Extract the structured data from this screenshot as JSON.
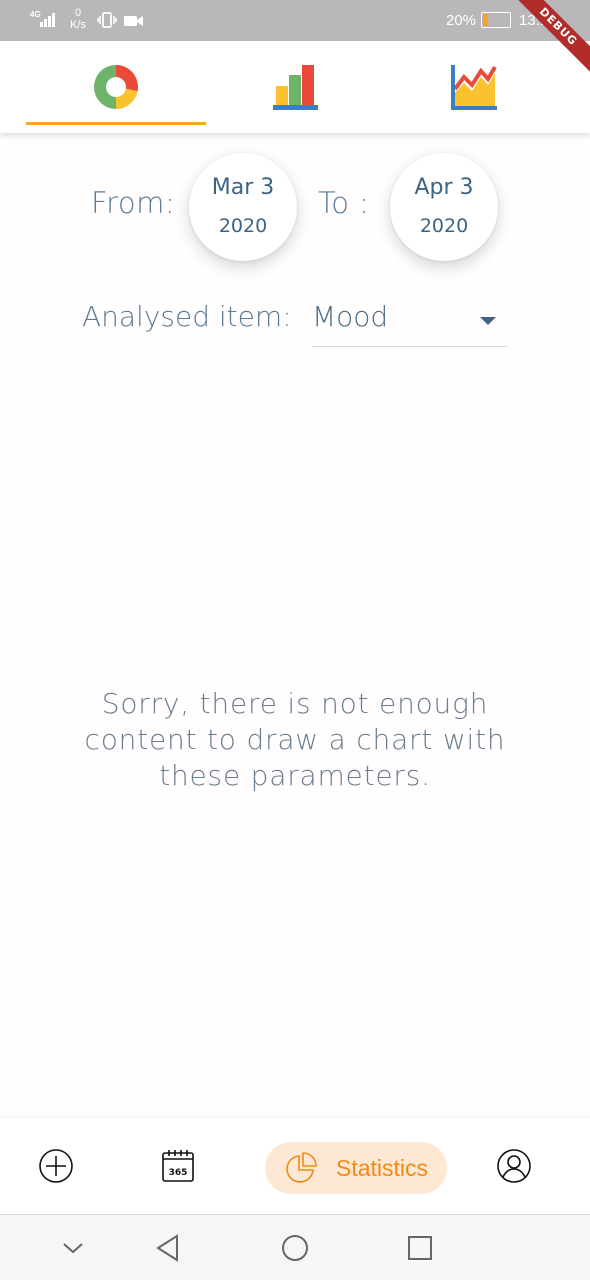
{
  "status_bar": {
    "network": "4G",
    "speed_value": "0",
    "speed_unit": "K/s",
    "battery_percent": "20%",
    "time": "13:10",
    "debug_label": "DEBUG",
    "icons": [
      "signal-icon",
      "vibrate-icon",
      "video-camera-icon",
      "battery-icon"
    ]
  },
  "chart_tabs": {
    "selected": 0,
    "items": [
      {
        "name": "pie-chart-tab",
        "icon": "donut-chart-icon"
      },
      {
        "name": "bar-chart-tab",
        "icon": "bar-chart-icon"
      },
      {
        "name": "line-chart-tab",
        "icon": "area-chart-icon"
      }
    ],
    "indicator_color": "#f5a623"
  },
  "date_range": {
    "from_label": "From:",
    "from_month_day": "Mar 3",
    "from_year": "2020",
    "to_label": "To :",
    "to_month_day": "Apr 3",
    "to_year": "2020"
  },
  "analysed_item": {
    "label": "Analysed item:",
    "value": "Mood"
  },
  "empty_message": {
    "line1": "Sorry, there is not enough",
    "line2": "content to draw a chart with",
    "line3": "these parameters."
  },
  "bottom_nav": {
    "items": [
      {
        "name": "add-entry",
        "icon": "plus-circle-icon"
      },
      {
        "name": "calendar",
        "icon": "calendar-365-icon"
      },
      {
        "name": "statistics",
        "icon": "pie-chart-icon",
        "label": "Statistics",
        "active": true
      },
      {
        "name": "profile",
        "icon": "user-icon"
      }
    ],
    "active_color": "#ef8a17",
    "active_bg": "#ffe8d3"
  },
  "system_nav": {
    "icons": [
      "chevron-down-icon",
      "back-icon",
      "home-icon",
      "recents-icon"
    ]
  }
}
